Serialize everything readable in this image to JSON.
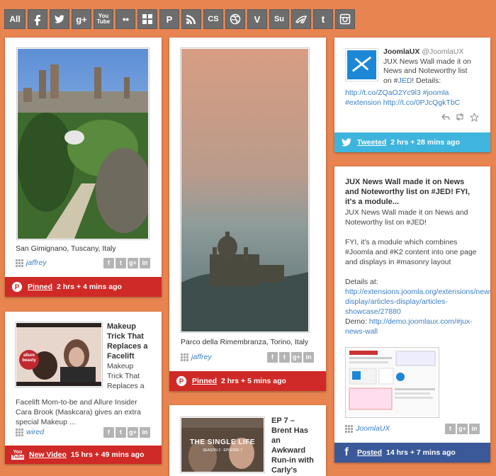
{
  "filter_bar": {
    "all_label": "All",
    "icons": [
      "facebook-icon",
      "twitter-icon",
      "google-plus-icon",
      "youtube-icon",
      "flickr-icon",
      "windows-icon",
      "pinterest-icon",
      "rss-icon",
      "lastfm-icon",
      "dribbble-icon",
      "vimeo-icon",
      "stumbleupon-icon",
      "deviantart-icon",
      "tumblr-icon",
      "instagram-icon"
    ],
    "glyph_g": "g+",
    "glyph_you": "You",
    "glyph_tube": "Tube",
    "glyph_dots": "●●",
    "glyph_p": "P",
    "glyph_lastfm": "CS",
    "glyph_v": "V",
    "glyph_su": "Su",
    "glyph_t": "t"
  },
  "cards": {
    "c1": {
      "caption": "San Gimignano, Tuscany, Italy",
      "author": "jaffrey",
      "source": "Pinned",
      "ago": "2 hrs + 4 mins ago",
      "footer_icon": "pinterest-icon",
      "footer_glyph": "P"
    },
    "c2": {
      "caption": "Parco della Rimembranza, Torino, Italy",
      "author": "jaffrey",
      "source": "Pinned",
      "ago": "2 hrs + 5 mins ago",
      "footer_icon": "pinterest-icon",
      "footer_glyph": "P"
    },
    "c3": {
      "name": "JoomlaUX",
      "handle": "@JoomlaUX",
      "text_1": "JUX News Wall made it on",
      "text_2": "News and Noteworthy list",
      "text_3_pre": "on #",
      "text_3_link": "JED",
      "text_3_post": "! Details:",
      "link_1": "http://t.co/ZQaO2Yc9l3",
      "link_1_tag": "#joomla",
      "link_2_tag": "#extension",
      "link_2": "http://t.co/0PJcQgkTbC",
      "source": "Tweeted",
      "ago": "2 hrs + 28 mins ago",
      "footer_icon": "twitter-icon"
    },
    "c4": {
      "title_1": "JUX News Wall made it on News",
      "title_2": "and Noteworthy list on #JED! FYI,",
      "title_3": "it's a module...",
      "p1_1": "JUX News Wall made it on News and",
      "p1_2": "Noteworthy list on #JED!",
      "p2_1": "FYI, it's a module which combines",
      "p2_2": "#Joomla and #K2 content into one page",
      "p2_3": "and displays in #masonry layout",
      "p3_1": "Details at:",
      "link_a1": "http://extensions.joomla.org/extensions/news-",
      "link_a2": "display/articles-display/articles-",
      "link_a3": "showcase/27880",
      "demo_label": "Demo: ",
      "link_b1": "http://demo.joomlaux.com/#jux-",
      "link_b2": "news-wall",
      "author": "JoomlaUX",
      "source": "Posted",
      "ago": "14 hrs + 7 mins ago",
      "footer_icon": "facebook-icon",
      "footer_glyph": "f"
    },
    "c5": {
      "title_1": "Makeup",
      "title_2": "Trick That",
      "title_3": "Replaces a",
      "title_4": "Facelift",
      "desc_1": "Makeup",
      "desc_2": "Trick That",
      "desc_3": "Replaces a",
      "desc_4": "Facelift Mom-to-be and Allure Insider",
      "desc_5": "Cara Brook (Maskcara) gives an extra",
      "desc_6": "special Makeup ...",
      "author": "wired",
      "source": "New Video",
      "ago": "15 hrs + 49 mins ago",
      "footer_icon": "youtube-icon",
      "footer_you": "You",
      "footer_tube": "Tube",
      "thumb_badge_1": "allure",
      "thumb_badge_2": "beauty"
    },
    "c6": {
      "title_1": "EP 7 –",
      "title_2": "Brent Has",
      "title_3": "an",
      "title_4": "Awkward",
      "title_5": "Run-in with",
      "title_6": "Carly's",
      "thumb_text": "THE SINGLE LIFE",
      "thumb_sub": "SEASON 2 - EPISODE 7"
    }
  },
  "share_labels": {
    "f": "f",
    "t": "t",
    "g": "g+",
    "in": "in"
  },
  "colors": {
    "background": "#e8844f",
    "pinterest": "#cf2a27",
    "twitter": "#3fb5dd",
    "facebook": "#3b5998",
    "link": "#3a7fc4"
  }
}
